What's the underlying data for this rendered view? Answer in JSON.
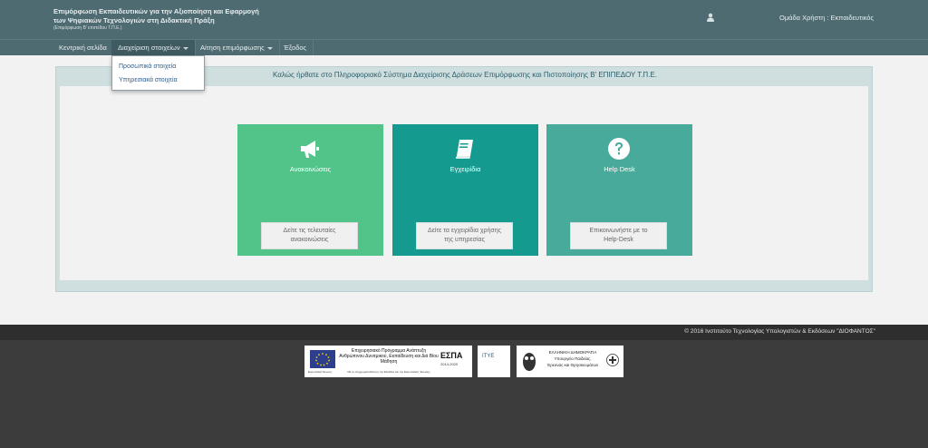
{
  "header": {
    "title_line1": "Επιμόρφωση Εκπαιδευτικών για την Αξιοποίηση και Εφαρμογή",
    "title_line2": "των Ψηφιακών Τεχνολογιών στη Διδακτική Πράξη",
    "title_line3": "(Επιμόρφωση Β' επιπέδου Τ.Π.Ε.)",
    "user_icon": "user-icon",
    "user_group": "Ομάδα Χρήστη : Εκπαιδευτικός"
  },
  "nav": {
    "items": [
      {
        "label": "Κεντρική σελίδα"
      },
      {
        "label": "Διαχείριση στοιχείων"
      },
      {
        "label": "Αίτηση επιμόρφωσης"
      },
      {
        "label": "Έξοδος"
      }
    ],
    "dropdown": [
      "Προσωπικά στοιχεία",
      "Υπηρεσιακά στοιχεία"
    ]
  },
  "main": {
    "welcome": "Καλώς ήρθατε στο Πληροφοριακό Σύστημα Διαχείρισης Δράσεων Επιμόρφωσης και Πιστοποίησης Β' ΕΠΙΠΕΔΟΥ Τ.Π.Ε.",
    "tiles": [
      {
        "icon": "megaphone-icon",
        "title": "Ανακοινώσεις",
        "button": "Δείτε τις τελευταίες ανακοινώσεις",
        "color": "#52c48a"
      },
      {
        "icon": "book-icon",
        "title": "Εγχειρίδια",
        "button": "Δείτε τα εγχειρίδια χρήσης της υπηρεσίας",
        "color": "#149a8e"
      },
      {
        "icon": "question-icon",
        "title": "Help Desk",
        "button": "Επικοινωνήστε με το Help-Desk",
        "color": "#47aa9a"
      }
    ]
  },
  "footer": {
    "copyright": "© 2016 Ινστιτούτο Τεχνολογίας Υπολογιστών & Εκδόσεων \"ΔΙΟΦΑΝΤΟΣ\"",
    "logos": {
      "eu_caption": "Ευρωπαϊκή Ένωση",
      "program": "Επιχειρησιακό Πρόγραμμα Ανάπτυξη Ανθρώπινου Δυναμικού, Εκπαίδευση και Διά Βίου Μάθηση",
      "program_small": "Με τη συγχρηματοδότηση της Ελλάδας και της Ευρωπαϊκής Ένωσης",
      "espa": "ΕΣΠΑ",
      "espa_years": "2014-2020",
      "ite": "ΙΤΥΕ",
      "gov_line1": "ΕΛΛΗΝΙΚΗ ΔΗΜΟΚΡΑΤΙΑ",
      "gov_line2": "Υπουργείο Παιδείας,",
      "gov_line3": "Έρευνας και Θρησκευμάτων"
    }
  }
}
